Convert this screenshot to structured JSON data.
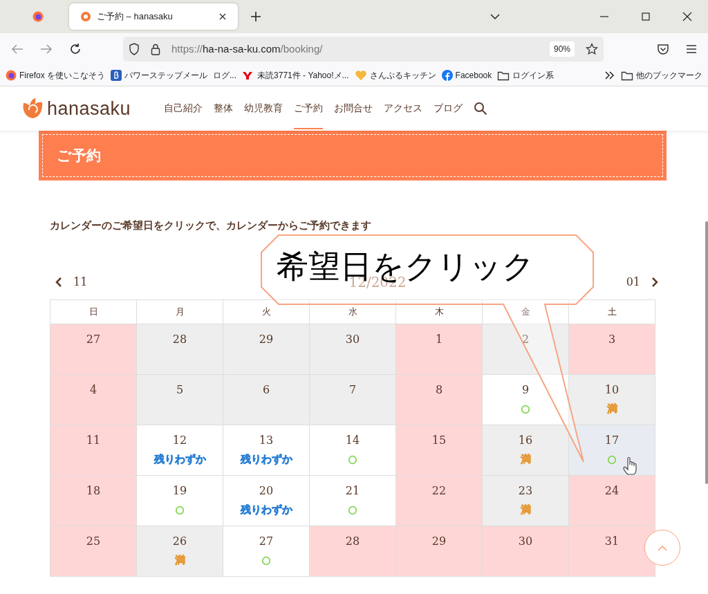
{
  "browser": {
    "tabs": [
      {
        "selected": false
      },
      {
        "title": "ご予約 – hanasaku",
        "selected": true
      }
    ],
    "url_host": "https://ha-na-sa-ku.com",
    "url_path": "/booking/",
    "zoom": "90%",
    "bookmarks": [
      {
        "label": "Firefox を使いこなそう"
      },
      {
        "label": "パワーステップメール"
      },
      {
        "label": "ログ..."
      },
      {
        "label": "未読3771件 - Yahoo!メ..."
      },
      {
        "label": "さんぷるキッチン"
      },
      {
        "label": "Facebook"
      },
      {
        "label": "ログイン系"
      }
    ],
    "other_bookmarks": "他のブックマーク"
  },
  "site": {
    "logo": "hanasaku",
    "nav": [
      {
        "label": "自己紹介",
        "selected": false
      },
      {
        "label": "整体",
        "selected": false
      },
      {
        "label": "幼児教育",
        "selected": false
      },
      {
        "label": "ご予約",
        "selected": true
      },
      {
        "label": "お問合せ",
        "selected": false
      },
      {
        "label": "アクセス",
        "selected": false
      },
      {
        "label": "ブログ",
        "selected": false
      }
    ]
  },
  "page_title": "ご予約",
  "instruction": "カレンダーのご希望日をクリックで、カレンダーからご予約できます",
  "calendar": {
    "prev": "11",
    "title": "12/2022",
    "next": "01",
    "weekdays": [
      "日",
      "月",
      "火",
      "水",
      "木",
      "金",
      "土"
    ],
    "weeks": [
      [
        {
          "day": "27",
          "kind": "holiday"
        },
        {
          "day": "28",
          "kind": "closed"
        },
        {
          "day": "29",
          "kind": "closed"
        },
        {
          "day": "30",
          "kind": "closed"
        },
        {
          "day": "1",
          "kind": "holiday"
        },
        {
          "day": "2",
          "kind": "closed"
        },
        {
          "day": "3",
          "kind": "holiday"
        }
      ],
      [
        {
          "day": "4",
          "kind": "holiday"
        },
        {
          "day": "5",
          "kind": "closed"
        },
        {
          "day": "6",
          "kind": "closed"
        },
        {
          "day": "7",
          "kind": "closed"
        },
        {
          "day": "8",
          "kind": "holiday"
        },
        {
          "day": "9",
          "kind": "open",
          "status": "○",
          "color": "#7bd44a"
        },
        {
          "day": "10",
          "kind": "closed",
          "status": "満",
          "color": "#e59a38"
        }
      ],
      [
        {
          "day": "11",
          "kind": "holiday"
        },
        {
          "day": "12",
          "kind": "open",
          "status": "残りわずか",
          "color": "#2a7fd4"
        },
        {
          "day": "13",
          "kind": "open",
          "status": "残りわずか",
          "color": "#2a7fd4"
        },
        {
          "day": "14",
          "kind": "open",
          "status": "○",
          "color": "#7bd44a"
        },
        {
          "day": "15",
          "kind": "holiday"
        },
        {
          "day": "16",
          "kind": "closed",
          "status": "満",
          "color": "#e59a38"
        },
        {
          "day": "17",
          "kind": "hover",
          "status": "○",
          "color": "#7bd44a"
        }
      ],
      [
        {
          "day": "18",
          "kind": "holiday"
        },
        {
          "day": "19",
          "kind": "open",
          "status": "○",
          "color": "#7bd44a"
        },
        {
          "day": "20",
          "kind": "open",
          "status": "残りわずか",
          "color": "#2a7fd4"
        },
        {
          "day": "21",
          "kind": "open",
          "status": "○",
          "color": "#7bd44a"
        },
        {
          "day": "22",
          "kind": "holiday"
        },
        {
          "day": "23",
          "kind": "closed",
          "status": "満",
          "color": "#e59a38"
        },
        {
          "day": "24",
          "kind": "holiday"
        }
      ],
      [
        {
          "day": "25",
          "kind": "holiday"
        },
        {
          "day": "26",
          "kind": "closed",
          "status": "満",
          "color": "#e59a38"
        },
        {
          "day": "27",
          "kind": "open",
          "status": "○",
          "color": "#7bd44a"
        },
        {
          "day": "28",
          "kind": "holiday"
        },
        {
          "day": "29",
          "kind": "holiday"
        },
        {
          "day": "30",
          "kind": "holiday"
        },
        {
          "day": "31",
          "kind": "holiday"
        }
      ]
    ]
  },
  "callout": {
    "text": "希望日をクリック"
  }
}
